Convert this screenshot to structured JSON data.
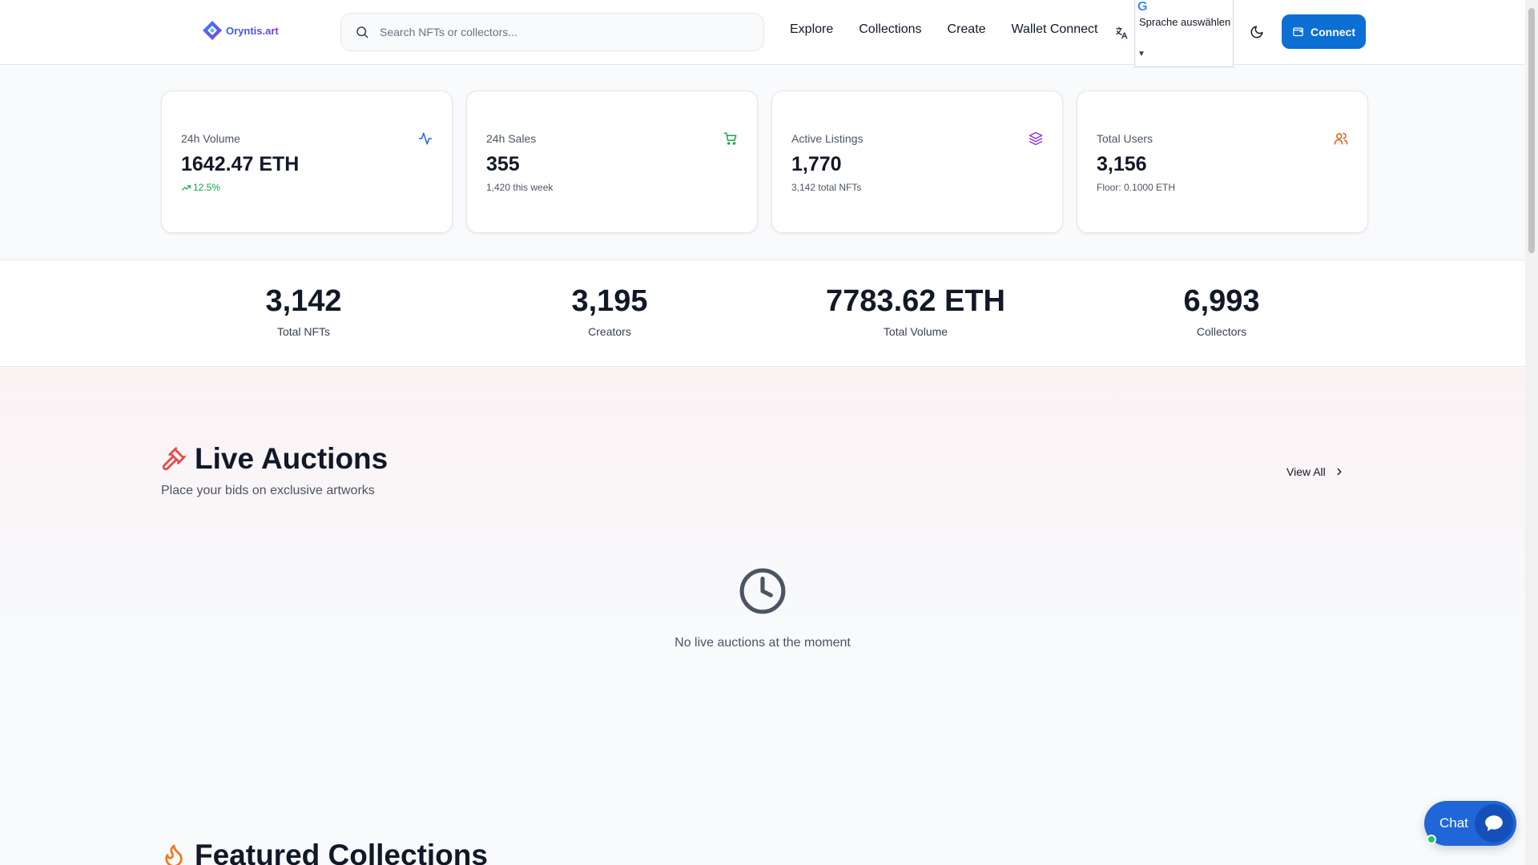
{
  "header": {
    "logo_text": "Oryntis.art",
    "search_placeholder": "Search NFTs or collectors...",
    "nav": [
      "Explore",
      "Collections",
      "Create",
      "Wallet Connect"
    ],
    "language_selector": {
      "google_mark": "G",
      "label": "Sprache auswählen",
      "arrow": "▼"
    },
    "connect_label": "Connect"
  },
  "cards": [
    {
      "label": "24h Volume",
      "value": "1642.47 ETH",
      "sub": "12.5%",
      "icon": "activity-icon",
      "icon_color": "#2563eb"
    },
    {
      "label": "24h Sales",
      "value": "355",
      "sub": "1,420 this week",
      "icon": "shopping-cart-icon",
      "icon_color": "#16a34a"
    },
    {
      "label": "Active Listings",
      "value": "1,770",
      "sub": "3,142 total NFTs",
      "icon": "layers-icon",
      "icon_color": "#9333ea"
    },
    {
      "label": "Total Users",
      "value": "3,156",
      "sub": "Floor: 0.1000 ETH",
      "icon": "users-icon",
      "icon_color": "#ea580c"
    }
  ],
  "stats": [
    {
      "value": "3,142",
      "label": "Total NFTs"
    },
    {
      "value": "3,195",
      "label": "Creators"
    },
    {
      "value": "7783.62 ETH",
      "label": "Total Volume"
    },
    {
      "value": "6,993",
      "label": "Collectors"
    }
  ],
  "live_auctions": {
    "title": "Live Auctions",
    "subtitle": "Place your bids on exclusive artworks",
    "view_all": "View All",
    "empty_message": "No live auctions at the moment"
  },
  "featured": {
    "title": "Featured Collections"
  },
  "chat": {
    "label": "Chat"
  },
  "colors": {
    "primary": "#0b6fd3",
    "positive": "#16a34a",
    "auction_icon": "#ef4444",
    "fire_icon": "#f97316"
  }
}
